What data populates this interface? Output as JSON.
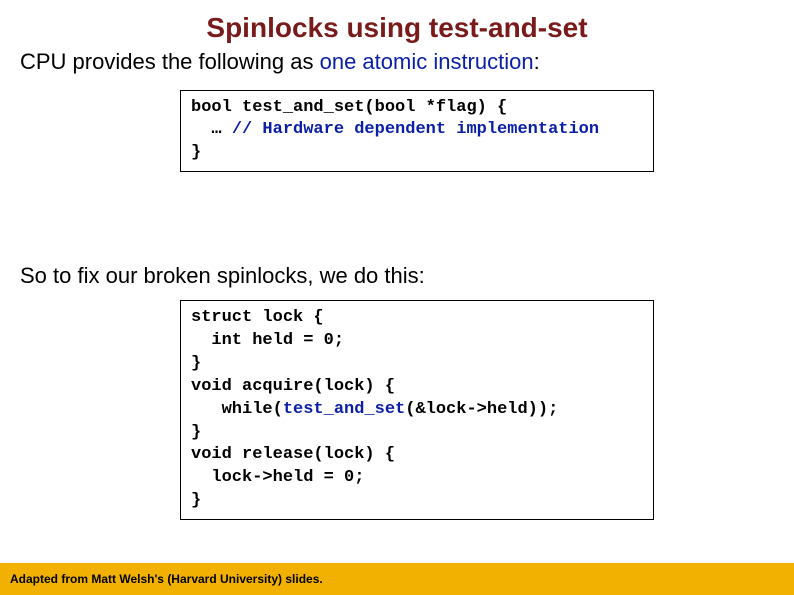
{
  "title": "Spinlocks using test-and-set",
  "line1_a": "CPU provides the following as ",
  "line1_b": "one atomic instruction",
  "line1_c": ":",
  "code1": {
    "l1": "bool test_and_set(bool *flag) {",
    "l2a": "  … ",
    "l2b": "// Hardware dependent implementation",
    "l3": "}"
  },
  "line2": "So to fix our broken spinlocks, we do this:",
  "code2": {
    "l1": "struct lock {",
    "l2": "  int held = 0;",
    "l3": "}",
    "l4": "void acquire(lock) {",
    "l5a": "   while(",
    "l5b": "test_and_set",
    "l5c": "(&lock->held));",
    "l6": "}",
    "l7": "void release(lock) {",
    "l8": "  lock->held = 0;",
    "l9": "}"
  },
  "footer": "Adapted from Matt Welsh's (Harvard University) slides."
}
